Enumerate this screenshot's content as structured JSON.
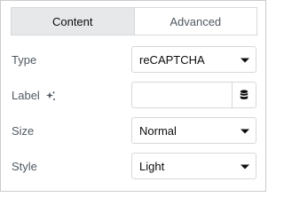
{
  "tabs": [
    {
      "label": "Content",
      "active": true
    },
    {
      "label": "Advanced",
      "active": false
    }
  ],
  "fields": {
    "type": {
      "label": "Type",
      "value": "reCAPTCHA"
    },
    "label": {
      "label": "Label",
      "value": "",
      "placeholder": "",
      "ai_icon": "ai-sparkle-icon",
      "dynamic_icon": "database-icon"
    },
    "size": {
      "label": "Size",
      "value": "Normal"
    },
    "style": {
      "label": "Style",
      "value": "Light"
    }
  },
  "colors": {
    "active_tab_bg": "#e6e8ea",
    "border": "#d5d8dc",
    "label_text": "#515962",
    "value_text": "#0c0d0e"
  }
}
